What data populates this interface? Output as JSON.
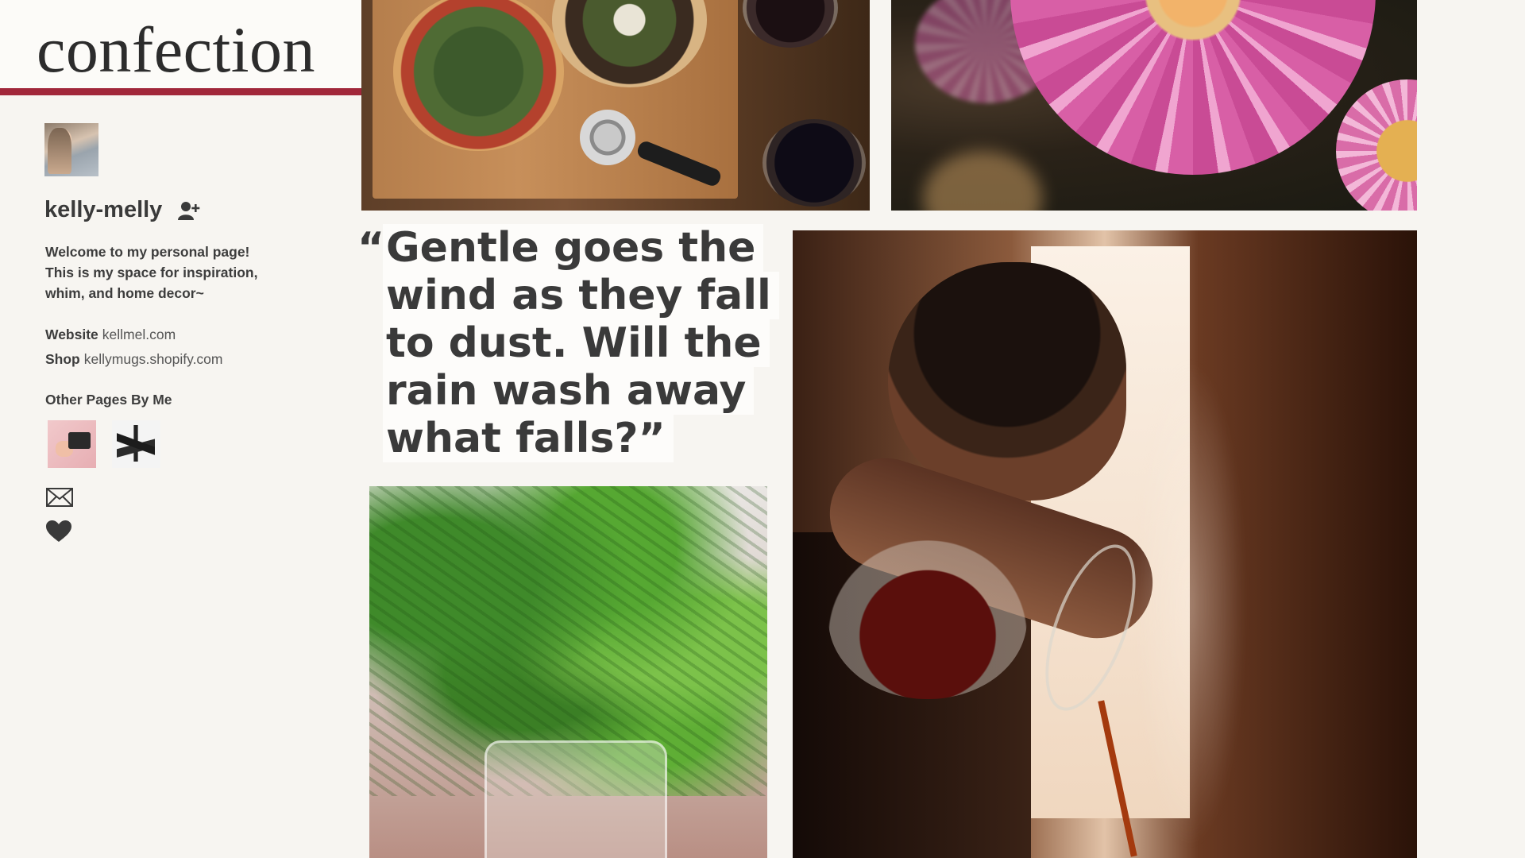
{
  "brand": {
    "title": "confection",
    "accent": "#a1273a"
  },
  "profile": {
    "username": "kelly-melly",
    "follow_icon": "follow-user-icon",
    "bio": [
      "Welcome to my personal page!",
      "This is my space for inspiration,",
      "whim, and home decor~"
    ],
    "website_label": "Website",
    "website_value": "kellmel.com",
    "shop_label": "Shop",
    "shop_value": "kellymugs.shopify.com",
    "other_pages_label": "Other Pages By Me",
    "actions": [
      "mail-icon",
      "heart-icon"
    ]
  },
  "quote": {
    "open_mark": "“",
    "lines": [
      "Gentle goes the",
      "wind as they fall",
      "to dust. Will the",
      "rain wash away",
      "what falls?”"
    ]
  },
  "photos": [
    "pizza",
    "flower",
    "fern",
    "coffee"
  ]
}
